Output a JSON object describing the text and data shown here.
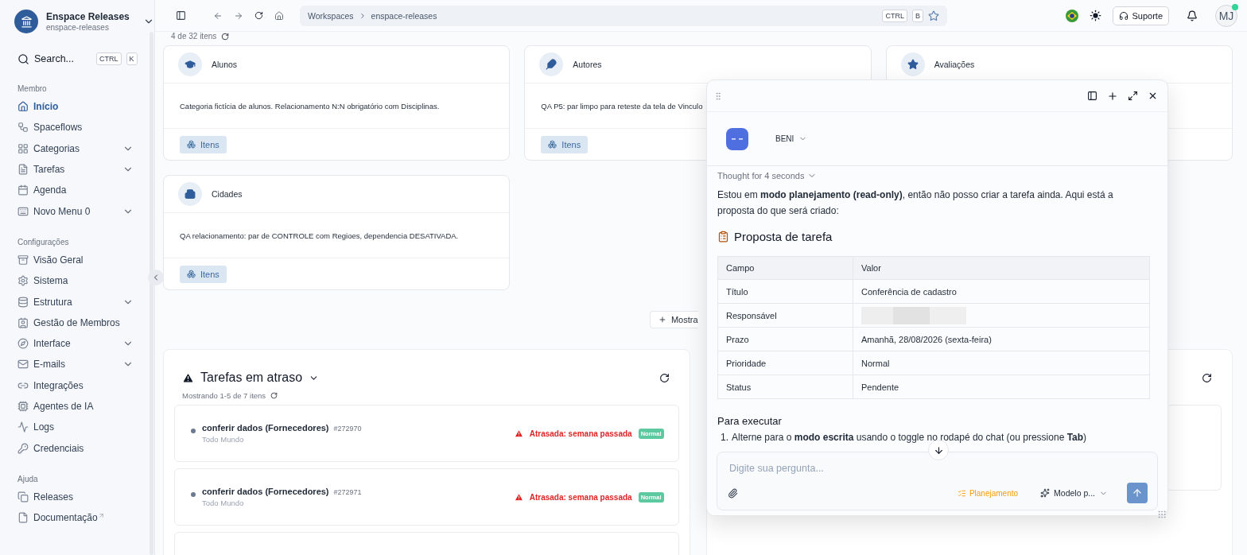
{
  "workspace": {
    "name": "Enspace Releases",
    "slug": "enspace-releases"
  },
  "search": {
    "label": "Search...",
    "keys": [
      "CTRL",
      "K"
    ]
  },
  "sidebar": {
    "sections": [
      {
        "title": "Membro",
        "items": [
          {
            "label": "Início",
            "selected": true,
            "expandable": false
          },
          {
            "label": "Spaceflows",
            "selected": false,
            "expandable": false
          },
          {
            "label": "Categorias",
            "selected": false,
            "expandable": true
          },
          {
            "label": "Tarefas",
            "selected": false,
            "expandable": true
          },
          {
            "label": "Agenda",
            "selected": false,
            "expandable": false
          },
          {
            "label": "Novo Menu 0",
            "selected": false,
            "expandable": true
          }
        ]
      },
      {
        "title": "Configurações",
        "items": [
          {
            "label": "Visão Geral",
            "selected": false,
            "expandable": false
          },
          {
            "label": "Sistema",
            "selected": false,
            "expandable": false
          },
          {
            "label": "Estrutura",
            "selected": false,
            "expandable": true
          },
          {
            "label": "Gestão de Membros",
            "selected": false,
            "expandable": false
          },
          {
            "label": "Interface",
            "selected": false,
            "expandable": true
          },
          {
            "label": "E-mails",
            "selected": false,
            "expandable": true
          },
          {
            "label": "Integrações",
            "selected": false,
            "expandable": false
          },
          {
            "label": "Agentes de IA",
            "selected": false,
            "expandable": false
          },
          {
            "label": "Logs",
            "selected": false,
            "expandable": false
          },
          {
            "label": "Credenciais",
            "selected": false,
            "expandable": false
          }
        ]
      },
      {
        "title": "Ajuda",
        "items": [
          {
            "label": "Releases",
            "selected": false,
            "expandable": false
          },
          {
            "label": "Documentação",
            "selected": false,
            "expandable": false,
            "external": true
          }
        ]
      }
    ]
  },
  "topbar": {
    "breadcrumb": [
      "Workspaces",
      "enspace-releases"
    ],
    "shortcut": [
      "CTRL",
      "B"
    ],
    "support": "Suporte",
    "avatar": "MJ"
  },
  "categories": {
    "count": "4 de 32 itens",
    "more": "Mostra",
    "cards": [
      {
        "title": "Alunos",
        "description": "Categoria fictícia de alunos. Relacionamento N:N obrigatório com Disciplinas.",
        "button": "Itens"
      },
      {
        "title": "Autores",
        "description": "QA P5: par limpo para reteste da tela de Vinculo",
        "button": "Itens"
      },
      {
        "title": "Avaliações"
      },
      {
        "title": "Cidades",
        "description": "QA relacionamento: par de CONTROLE com Regioes, dependencia DESATIVADA.",
        "button": "Itens"
      }
    ]
  },
  "overdue": {
    "title": "Tarefas em atraso",
    "count": "Mostrando 1-5 de 7 itens",
    "tasks": [
      {
        "title": "conferir dados (Fornecedores)",
        "id": "#272970",
        "assignee": "Todo Mundo",
        "status": "Atrasada: semana passada",
        "priority": "Normal"
      },
      {
        "title": "conferir dados (Fornecedores)",
        "id": "#272971",
        "assignee": "Todo Mundo",
        "status": "Atrasada: semana passada",
        "priority": "Normal"
      }
    ]
  },
  "chat": {
    "agent": "BENI",
    "thought": "Thought for 4 seconds",
    "intro": "Estou em **modo planejamento (read-only)**, então não posso criar a tarefa ainda. Aqui está a proposta do que será criado:",
    "heading": "Proposta de tarefa",
    "table": {
      "columns": [
        "Campo",
        "Valor"
      ],
      "rows": [
        {
          "field": "Título",
          "value": "Conferência de cadastro",
          "redacted": false
        },
        {
          "field": "Responsável",
          "redacted": true
        },
        {
          "field": "Prazo",
          "value": "Amanhã, 28/08/2026 (sexta-feira)",
          "redacted": false
        },
        {
          "field": "Prioridade",
          "value": "Normal",
          "redacted": false
        },
        {
          "field": "Status",
          "value": "Pendente",
          "redacted": false
        }
      ]
    },
    "steps_heading": "Para executar",
    "steps": [
      {
        "number": "1.",
        "text": "Alterne para o **modo escrita** usando o toggle no rodapé do chat (ou pressione **Tab**)"
      }
    ],
    "composer": {
      "placeholder": "Digite sua pergunta...",
      "mode": "Planejamento",
      "model": "Modelo p..."
    }
  }
}
